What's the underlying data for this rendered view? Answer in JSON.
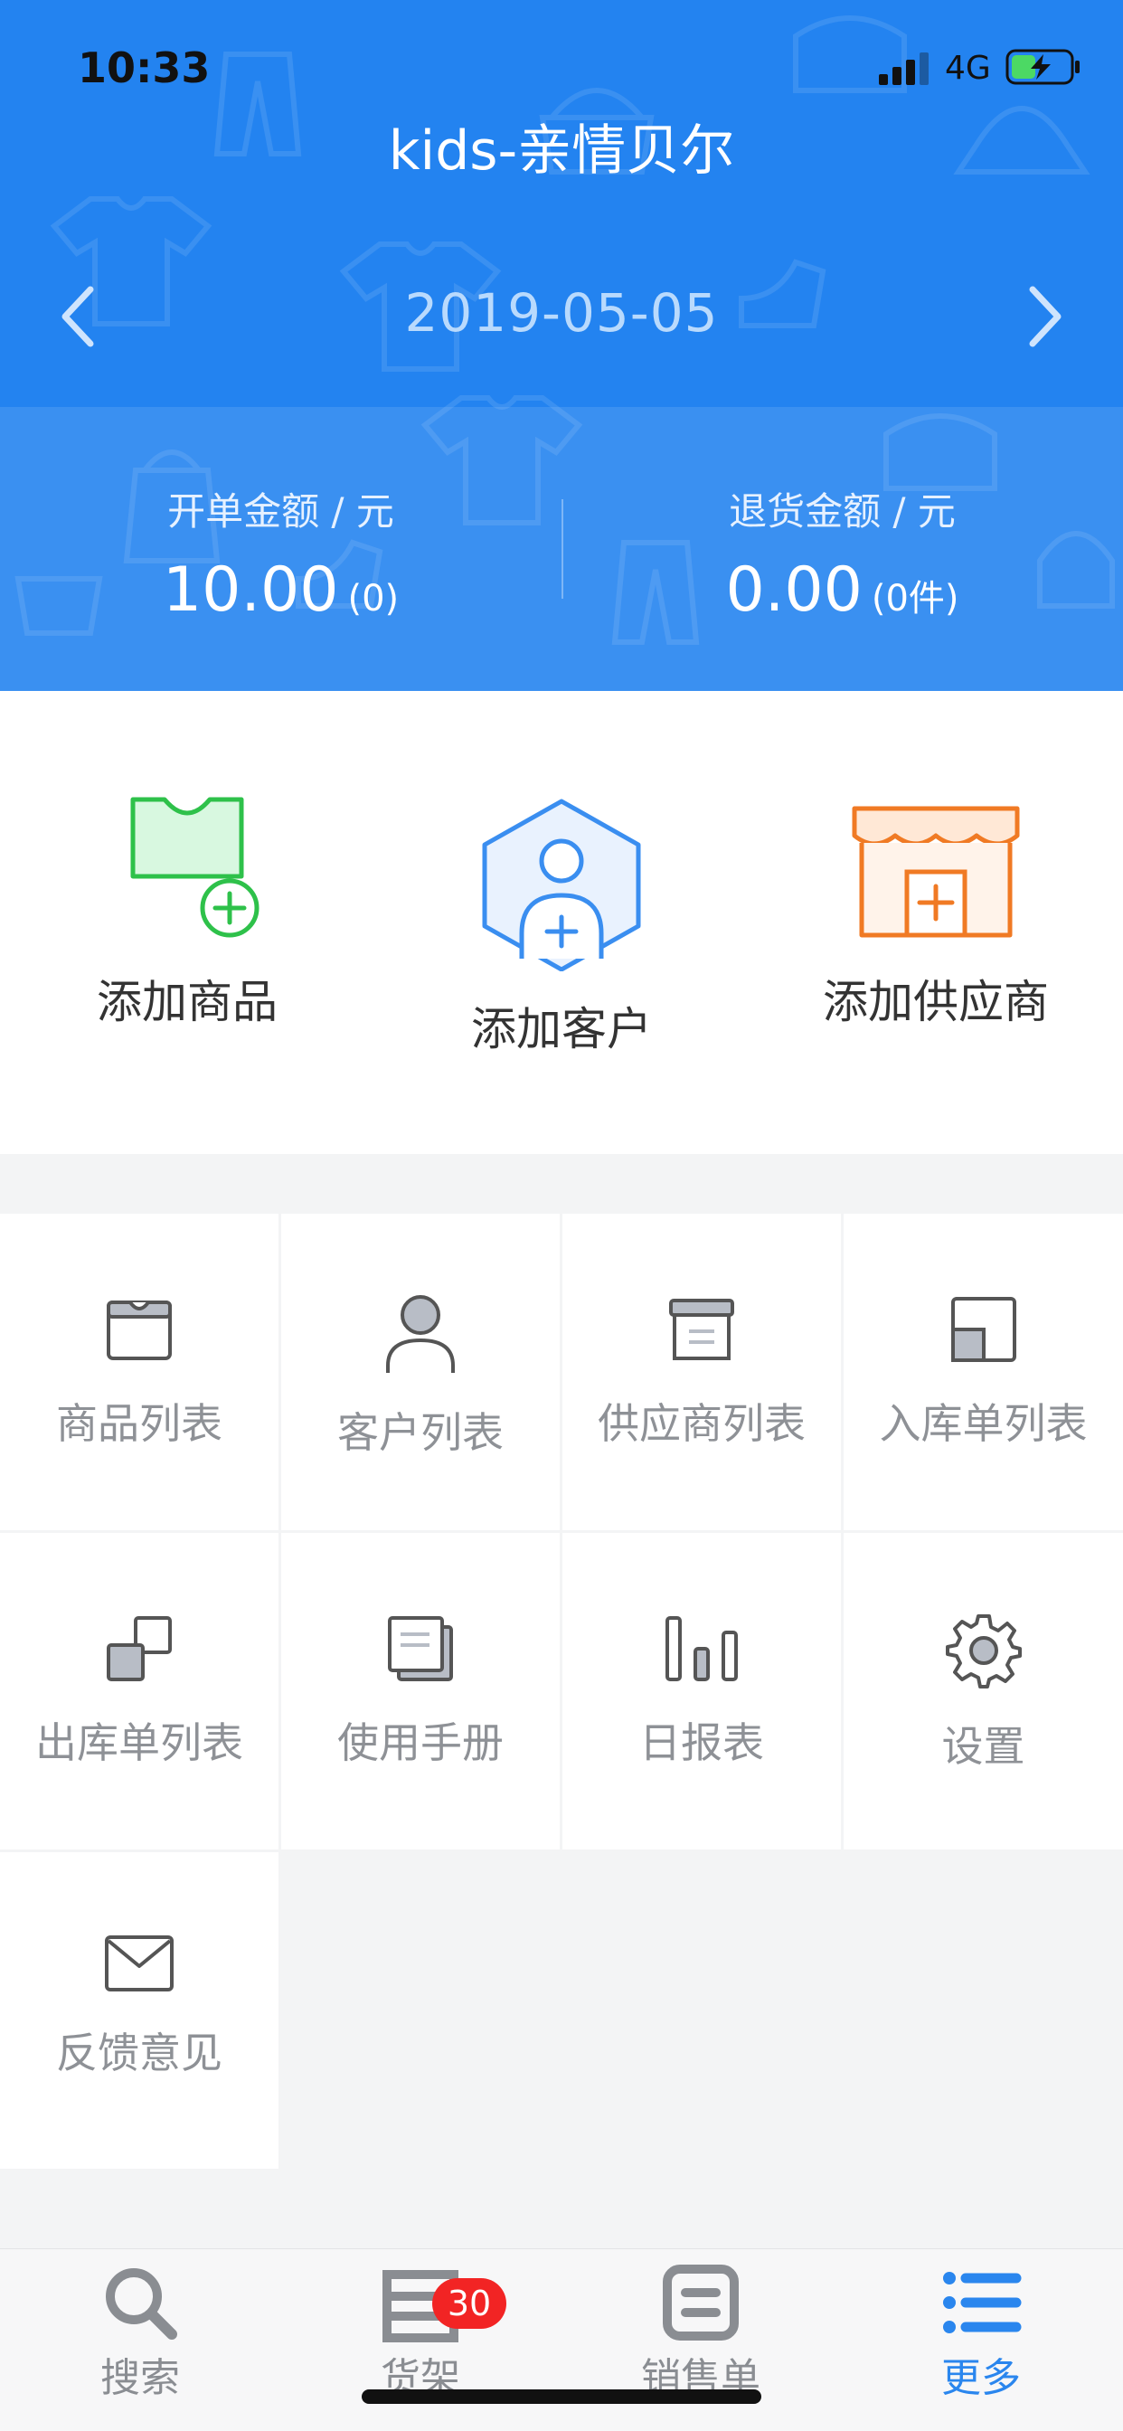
{
  "status_bar": {
    "time": "10:33",
    "network": "4G"
  },
  "header": {
    "title": "kids-亲情贝尔",
    "date": "2019-05-05",
    "stats": [
      {
        "title": "开单金额 / 元",
        "value": "10.00",
        "sub": "(0)"
      },
      {
        "title": "退货金额 / 元",
        "value": "0.00",
        "sub": "(0件)"
      }
    ]
  },
  "quick_actions": [
    {
      "label": "添加商品",
      "icon": "add-product-icon",
      "color": "#2ec14a"
    },
    {
      "label": "添加客户",
      "icon": "add-customer-icon",
      "color": "#3a8ef0"
    },
    {
      "label": "添加供应商",
      "icon": "add-supplier-icon",
      "color": "#f07a24"
    }
  ],
  "menu": [
    {
      "label": "商品列表",
      "icon": "product-box-icon"
    },
    {
      "label": "客户列表",
      "icon": "person-icon"
    },
    {
      "label": "供应商列表",
      "icon": "archive-box-icon"
    },
    {
      "label": "入库单列表",
      "icon": "inbound-icon"
    },
    {
      "label": "出库单列表",
      "icon": "outbound-icon"
    },
    {
      "label": "使用手册",
      "icon": "manual-icon"
    },
    {
      "label": "日报表",
      "icon": "bar-chart-icon"
    },
    {
      "label": "设置",
      "icon": "gear-icon"
    },
    {
      "label": "反馈意见",
      "icon": "envelope-icon"
    }
  ],
  "tabbar": {
    "badge": "30",
    "tabs": [
      {
        "label": "搜索",
        "icon": "search-icon",
        "active": false
      },
      {
        "label": "货架",
        "icon": "shelf-icon",
        "active": false
      },
      {
        "label": "销售单",
        "icon": "sales-order-icon",
        "active": false
      },
      {
        "label": "更多",
        "icon": "list-icon",
        "active": true
      }
    ]
  },
  "colors": {
    "header_blue": "#2383f0",
    "accent_blue": "#2a86ee",
    "badge_red": "#f22424",
    "icon_gray": "#8e9196"
  }
}
